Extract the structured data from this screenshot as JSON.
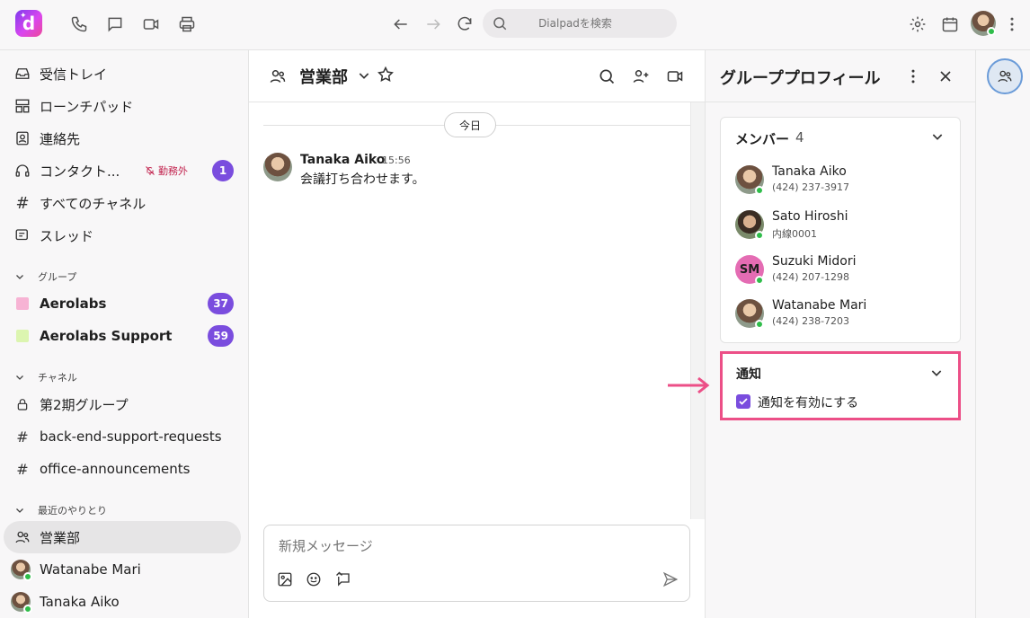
{
  "topbar": {
    "logo_letter": "d",
    "search_placeholder": "Dialpadを検索"
  },
  "sidebar": {
    "main_items": [
      {
        "label": "受信トレイ"
      },
      {
        "label": "ローンチパッド"
      },
      {
        "label": "連絡先"
      },
      {
        "label": "コンタクト...",
        "status": "勤務外",
        "badge": "1"
      },
      {
        "label": "すべてのチャネル"
      },
      {
        "label": "スレッド"
      }
    ],
    "groups_header": "グループ",
    "groups": [
      {
        "label": "Aerolabs",
        "badge": "37",
        "color": "#f7b3d4"
      },
      {
        "label": "Aerolabs Support",
        "badge": "59",
        "color": "#dcf5b0"
      }
    ],
    "channels_header": "チャネル",
    "channels": [
      {
        "label": "第2期グループ"
      },
      {
        "label": "back-end-support-requests"
      },
      {
        "label": "office-announcements"
      }
    ],
    "recent_header": "最近のやりとり",
    "recent": [
      {
        "label": "営業部"
      },
      {
        "label": "Watanabe Mari"
      },
      {
        "label": "Tanaka Aiko"
      }
    ]
  },
  "chat": {
    "title": "営業部",
    "date_divider": "今日",
    "messages": [
      {
        "author": "Tanaka Aiko",
        "time": "15:56",
        "text": "会議打ち合わせます。"
      }
    ],
    "composer_placeholder": "新規メッセージ"
  },
  "profile": {
    "title": "グループプロフィール",
    "members_label": "メンバー",
    "members_count": "4",
    "members": [
      {
        "name": "Tanaka Aiko",
        "sub": "(424) 237-3917",
        "initials": ""
      },
      {
        "name": "Sato Hiroshi",
        "sub": "内線0001",
        "initials": ""
      },
      {
        "name": "Suzuki Midori",
        "sub": "(424) 207-1298",
        "initials": "SM"
      },
      {
        "name": "Watanabe Mari",
        "sub": "(424) 238-7203",
        "initials": ""
      }
    ],
    "notifications_label": "通知",
    "notifications_checkbox_label": "通知を有効にする",
    "notifications_checked": true
  },
  "colors": {
    "accent": "#7a4dde",
    "highlight_border": "#ec4f87",
    "online": "#2fbd4a",
    "offduty": "#c2244f"
  }
}
